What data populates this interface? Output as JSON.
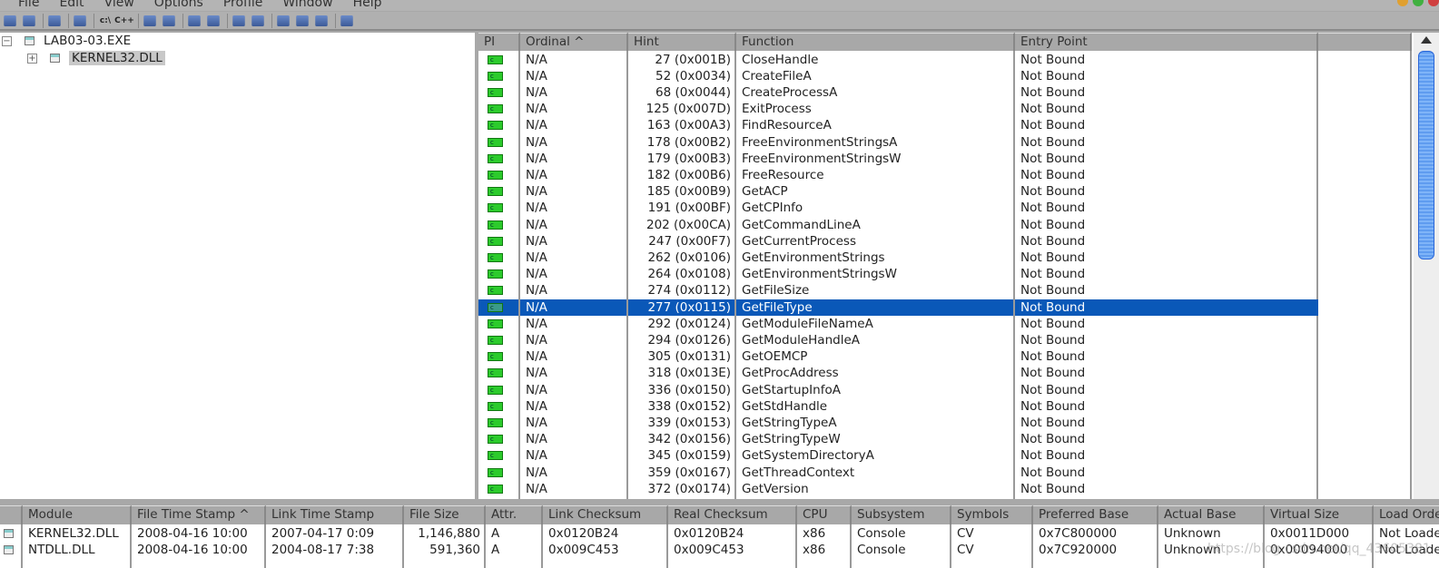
{
  "menu": [
    "File",
    "Edit",
    "View",
    "Options",
    "Profile",
    "Window",
    "Help"
  ],
  "toolbar": [
    "open",
    "save",
    "find",
    "copy",
    "c:\\",
    "c++",
    "undecorate",
    "properties",
    "system-info",
    "explore",
    "sort",
    "autoexpand",
    "cascade",
    "tile-h",
    "tile-v",
    "help"
  ],
  "tree": {
    "root": "LAB03-03.EXE",
    "child": "KERNEL32.DLL"
  },
  "imports": {
    "columns": [
      "PI",
      "Ordinal ^",
      "Hint",
      "Function",
      "Entry Point"
    ],
    "selected_index": 15,
    "rows": [
      [
        "N/A",
        "27 (0x001B)",
        "CloseHandle",
        "Not Bound"
      ],
      [
        "N/A",
        "52 (0x0034)",
        "CreateFileA",
        "Not Bound"
      ],
      [
        "N/A",
        "68 (0x0044)",
        "CreateProcessA",
        "Not Bound"
      ],
      [
        "N/A",
        "125 (0x007D)",
        "ExitProcess",
        "Not Bound"
      ],
      [
        "N/A",
        "163 (0x00A3)",
        "FindResourceA",
        "Not Bound"
      ],
      [
        "N/A",
        "178 (0x00B2)",
        "FreeEnvironmentStringsA",
        "Not Bound"
      ],
      [
        "N/A",
        "179 (0x00B3)",
        "FreeEnvironmentStringsW",
        "Not Bound"
      ],
      [
        "N/A",
        "182 (0x00B6)",
        "FreeResource",
        "Not Bound"
      ],
      [
        "N/A",
        "185 (0x00B9)",
        "GetACP",
        "Not Bound"
      ],
      [
        "N/A",
        "191 (0x00BF)",
        "GetCPInfo",
        "Not Bound"
      ],
      [
        "N/A",
        "202 (0x00CA)",
        "GetCommandLineA",
        "Not Bound"
      ],
      [
        "N/A",
        "247 (0x00F7)",
        "GetCurrentProcess",
        "Not Bound"
      ],
      [
        "N/A",
        "262 (0x0106)",
        "GetEnvironmentStrings",
        "Not Bound"
      ],
      [
        "N/A",
        "264 (0x0108)",
        "GetEnvironmentStringsW",
        "Not Bound"
      ],
      [
        "N/A",
        "274 (0x0112)",
        "GetFileSize",
        "Not Bound"
      ],
      [
        "N/A",
        "277 (0x0115)",
        "GetFileType",
        "Not Bound"
      ],
      [
        "N/A",
        "292 (0x0124)",
        "GetModuleFileNameA",
        "Not Bound"
      ],
      [
        "N/A",
        "294 (0x0126)",
        "GetModuleHandleA",
        "Not Bound"
      ],
      [
        "N/A",
        "305 (0x0131)",
        "GetOEMCP",
        "Not Bound"
      ],
      [
        "N/A",
        "318 (0x013E)",
        "GetProcAddress",
        "Not Bound"
      ],
      [
        "N/A",
        "336 (0x0150)",
        "GetStartupInfoA",
        "Not Bound"
      ],
      [
        "N/A",
        "338 (0x0152)",
        "GetStdHandle",
        "Not Bound"
      ],
      [
        "N/A",
        "339 (0x0153)",
        "GetStringTypeA",
        "Not Bound"
      ],
      [
        "N/A",
        "342 (0x0156)",
        "GetStringTypeW",
        "Not Bound"
      ],
      [
        "N/A",
        "345 (0x0159)",
        "GetSystemDirectoryA",
        "Not Bound"
      ],
      [
        "N/A",
        "359 (0x0167)",
        "GetThreadContext",
        "Not Bound"
      ],
      [
        "N/A",
        "372 (0x0174)",
        "GetVersion",
        "Not Bound"
      ]
    ]
  },
  "modules": {
    "columns": [
      "",
      "Module",
      "File Time Stamp ^",
      "Link Time Stamp",
      "File Size",
      "Attr.",
      "Link Checksum",
      "Real Checksum",
      "CPU",
      "Subsystem",
      "Symbols",
      "Preferred Base",
      "Actual Base",
      "Virtual Size",
      "Load Order"
    ],
    "rows": [
      [
        "KERNEL32.DLL",
        "2008-04-16 10:00",
        "2007-04-17   0:09",
        "1,146,880",
        "A",
        "0x0120B24",
        "0x0120B24",
        "x86",
        "Console",
        "CV",
        "0x7C800000",
        "Unknown",
        "0x0011D000",
        "Not Loaded"
      ],
      [
        "NTDLL.DLL",
        "2008-04-16 10:00",
        "2004-08-17   7:38",
        "591,360",
        "A",
        "0x009C453",
        "0x009C453",
        "x86",
        "Console",
        "CV",
        "0x7C920000",
        "Unknown",
        "0x00094000",
        "Not Loaded"
      ]
    ]
  },
  "watermark": "https://blog.csdn.net/qq_43605381",
  "colors": {
    "selection": "#0a58b8",
    "pi_icon": "#2ccb2c",
    "scroll_thumb": "#5f9cf0"
  }
}
